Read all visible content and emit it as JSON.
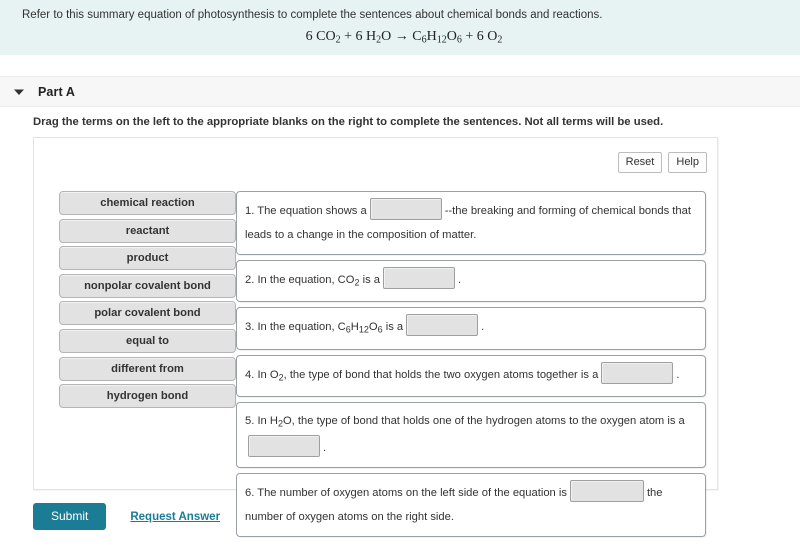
{
  "prompt": {
    "text": "Refer to this summary equation of photosynthesis to complete the sentences about chemical bonds and reactions.",
    "equation_parts": {
      "p1": "6 CO",
      "s1": "2",
      "p2": " + 6 H",
      "s2": "2",
      "p3": "O → C",
      "s3": "6",
      "p4": "H",
      "s4": "12",
      "p5": "O",
      "s5": "6",
      "p6": " + 6 O",
      "s6": "2"
    }
  },
  "part": {
    "title": "Part A",
    "caret_icon": "chevron-down-icon",
    "instruction": "Drag the terms on the left to the appropriate blanks on the right to complete the sentences. Not all terms will be used."
  },
  "tools": {
    "reset_label": "Reset",
    "help_label": "Help"
  },
  "terms": [
    {
      "label": "chemical reaction"
    },
    {
      "label": "reactant"
    },
    {
      "label": "product"
    },
    {
      "label": "nonpolar covalent bond"
    },
    {
      "label": "polar covalent bond"
    },
    {
      "label": "equal to"
    },
    {
      "label": "different from"
    },
    {
      "label": "hydrogen bond"
    }
  ],
  "sentences": [
    {
      "lead": "1. The equation shows a",
      "tail": "--the breaking and forming of chemical bonds that leads to a change in the composition of matter.",
      "blank_value": ""
    },
    {
      "lead_a": "2. In the equation, CO",
      "lead_sub": "2",
      "lead_b": " is a",
      "tail": ".",
      "blank_value": ""
    },
    {
      "lead_a": "3. In the equation, C",
      "sub1": "6",
      "mid1": "H",
      "sub2": "12",
      "mid2": "O",
      "sub3": "6",
      "lead_b": " is a",
      "tail": ".",
      "blank_value": ""
    },
    {
      "lead_a": "4. In O",
      "lead_sub": "2",
      "lead_b": ", the type of bond that holds the two oxygen atoms together is a",
      "tail": ".",
      "blank_value": ""
    },
    {
      "lead_a": "5. In H",
      "lead_sub": "2",
      "lead_b": "O, the type of bond that holds one of the hydrogen atoms to the oxygen atom is a",
      "tail": ".",
      "blank_value": ""
    },
    {
      "lead": "6. The number of oxygen atoms on the left side of the equation is",
      "tail": "the number of oxygen atoms on the right side.",
      "blank_value": ""
    }
  ],
  "footer": {
    "submit_label": "Submit",
    "request_answer_label": "Request Answer"
  },
  "colors": {
    "banner_bg": "#e7f3f3",
    "accent_teal": "#1b7d95",
    "tile_bg": "#e2e2e2",
    "part_header_bg": "#f7f7f7"
  }
}
